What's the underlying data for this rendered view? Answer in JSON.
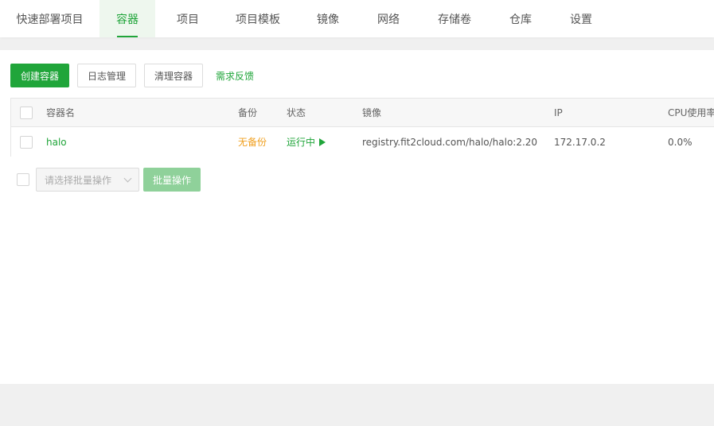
{
  "nav": {
    "tabs": [
      {
        "label": "快速部署项目"
      },
      {
        "label": "容器"
      },
      {
        "label": "项目"
      },
      {
        "label": "项目模板"
      },
      {
        "label": "镜像"
      },
      {
        "label": "网络"
      },
      {
        "label": "存储卷"
      },
      {
        "label": "仓库"
      },
      {
        "label": "设置"
      }
    ],
    "active_index": 1
  },
  "toolbar": {
    "create_label": "创建容器",
    "logs_label": "日志管理",
    "clean_label": "清理容器",
    "feedback_label": "需求反馈"
  },
  "table": {
    "headers": {
      "name": "容器名",
      "backup": "备份",
      "status": "状态",
      "image": "镜像",
      "ip": "IP",
      "cpu": "CPU使用率"
    },
    "rows": [
      {
        "name": "halo",
        "backup": "无备份",
        "status": "运行中",
        "image": "registry.fit2cloud.com/halo/halo:2.20",
        "ip": "172.17.0.2",
        "cpu": "0.0%"
      }
    ]
  },
  "batch": {
    "select_placeholder": "请选择批量操作",
    "button_label": "批量操作"
  },
  "colors": {
    "accent": "#20a53a",
    "warning": "#f0a020"
  }
}
